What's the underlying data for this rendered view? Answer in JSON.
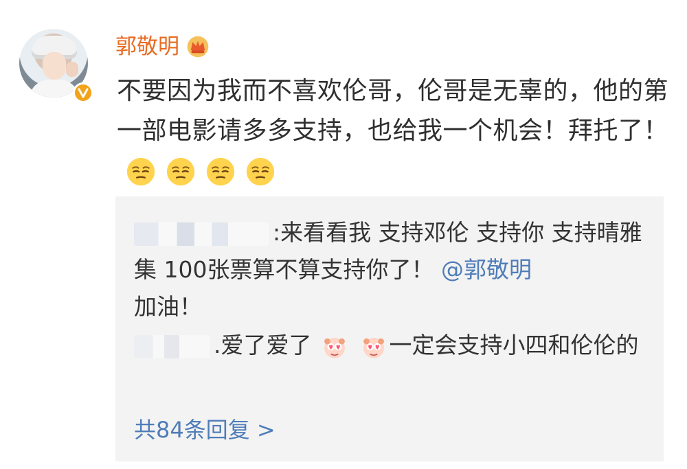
{
  "post": {
    "username": "郭敬明",
    "text": "不要因为我而不喜欢伦哥，伦哥是无辜的，他的第一部电影请多多支持，也给我一个机会！拜托了！",
    "emoji_icons": [
      "pensive-face-icon",
      "pensive-face-icon",
      "pensive-face-icon",
      "pensive-face-icon"
    ],
    "badges": [
      "crown-icon",
      "verified-v-icon"
    ]
  },
  "comments": {
    "items": [
      {
        "separator": ":",
        "text": "来看看我 支持邓伦 支持你 支持晴雅集 100张票算不算支持你了！",
        "mention": "@郭敬明",
        "suffix": "加油！"
      },
      {
        "separator": ".",
        "text_a": "爱了爱了",
        "text_b": "一定会支持小四和伦伦的",
        "sticker_icons": [
          "heart-eyes-sticker-icon",
          "heart-eyes-sticker-icon"
        ]
      }
    ],
    "reply_count": "共84条回复 >"
  },
  "colors": {
    "username": "#e86b22",
    "mention": "#4f7db8",
    "panel": "#f3f3f3"
  }
}
